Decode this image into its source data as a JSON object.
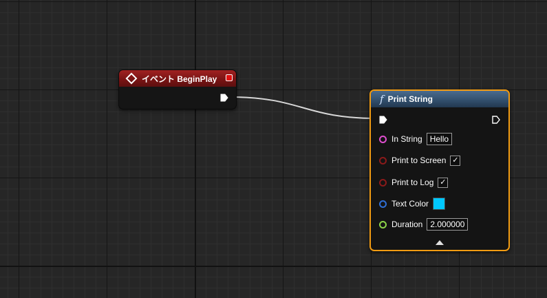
{
  "event_node": {
    "title": "イベント BeginPlay",
    "icon": "event-diamond-icon",
    "header_color": "#8a1a1a",
    "delegate_color": "#e01010"
  },
  "print_node": {
    "title": "Print String",
    "icon_glyph": "f",
    "header_color": "#3f5f82",
    "selected_border_color": "#f39c12",
    "pins": [
      {
        "label": "In String",
        "type": "string",
        "pin_color": "#e04fd0",
        "value": "Hello"
      },
      {
        "label": "Print to Screen",
        "type": "bool",
        "pin_color": "#8b1a1a",
        "checked": true
      },
      {
        "label": "Print to Log",
        "type": "bool",
        "pin_color": "#8b1a1a",
        "checked": true
      },
      {
        "label": "Text Color",
        "type": "color",
        "pin_color": "#2f6fd6",
        "value": "#00c8ff"
      },
      {
        "label": "Duration",
        "type": "float",
        "pin_color": "#8cd449",
        "value": "2.000000"
      }
    ],
    "check_glyph": "✓"
  },
  "wire": {
    "color": "#d8d8d8",
    "from": "event_node.exec_out",
    "to": "print_node.exec_in"
  }
}
